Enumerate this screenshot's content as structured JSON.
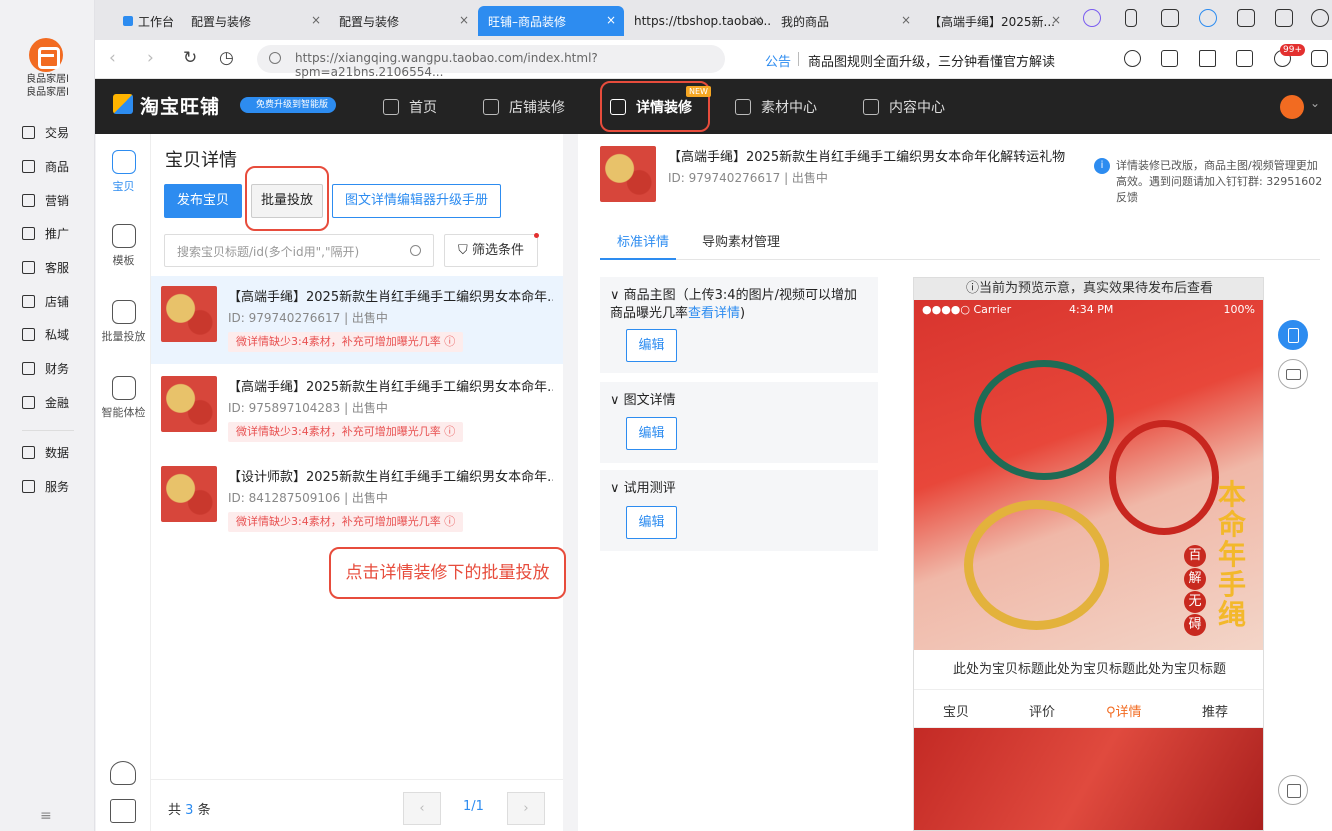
{
  "sidebar": {
    "app_name": "良品家居l\n良品家居l",
    "items": [
      {
        "label": "交易",
        "icon": "receipt-icon"
      },
      {
        "label": "商品",
        "icon": "goods-icon"
      },
      {
        "label": "营销",
        "icon": "coupon-icon"
      },
      {
        "label": "推广",
        "icon": "send-icon"
      },
      {
        "label": "客服",
        "icon": "headset-icon"
      },
      {
        "label": "店铺",
        "icon": "store-icon"
      },
      {
        "label": "私域",
        "icon": "users-icon"
      },
      {
        "label": "财务",
        "icon": "finance-icon"
      },
      {
        "label": "金融",
        "icon": "bag-icon"
      },
      {
        "label": "数据",
        "icon": "chart-icon"
      },
      {
        "label": "服务",
        "icon": "service-icon"
      }
    ]
  },
  "browser": {
    "tabs": [
      {
        "label": "工作台",
        "active": false
      },
      {
        "label": "配置与装修",
        "active": false
      },
      {
        "label": "配置与装修",
        "active": false
      },
      {
        "label": "旺铺–商品装修",
        "active": true
      },
      {
        "label": "https://tbshop.taobao...",
        "active": false
      },
      {
        "label": "我的商品",
        "active": false
      },
      {
        "label": "【高端手绳】2025新...",
        "active": false
      }
    ],
    "close_glyph": "×",
    "url": "https://xiangqing.wangpu.taobao.com/index.html?spm=a21bns.2106554...",
    "notice_label": "公告",
    "notice_text": "商品图规则全面升级，三分钟看懂官方解读",
    "badge": "99+"
  },
  "header": {
    "brand": "淘宝旺铺",
    "brand_badge": "免费升级到智能版",
    "nav": [
      {
        "label": "首页",
        "icon": "home-icon"
      },
      {
        "label": "店铺装修",
        "icon": "shop-icon"
      },
      {
        "label": "详情装修",
        "icon": "document-icon"
      },
      {
        "label": "素材中心",
        "icon": "folder-icon"
      },
      {
        "label": "内容中心",
        "icon": "play-icon"
      }
    ],
    "new_tag": "NEW"
  },
  "tools": [
    {
      "label": "宝贝"
    },
    {
      "label": "模板"
    },
    {
      "label": "批量投放"
    },
    {
      "label": "智能体检"
    }
  ],
  "list": {
    "title": "宝贝详情",
    "btn_publish": "发布宝贝",
    "btn_batch": "批量投放",
    "btn_manual": "图文详情编辑器升级手册",
    "search_placeholder": "搜索宝贝标题/id(多个id用\",\"隔开)",
    "filter_label": "筛选条件",
    "items": [
      {
        "title": "【高端手绳】2025新款生肖红手绳手工编织男女本命年...",
        "id": "ID: 979740276617 | 出售中",
        "warn": "微详情缺少3:4素材，补充可增加曝光几率 ⓘ"
      },
      {
        "title": "【高端手绳】2025新款生肖红手绳手工编织男女本命年...",
        "id": "ID: 975897104283 | 出售中",
        "warn": "微详情缺少3:4素材，补充可增加曝光几率 ⓘ"
      },
      {
        "title": "【设计师款】2025新款生肖红手绳手工编织男女本命年...",
        "id": "ID: 841287509106 | 出售中",
        "warn": "微详情缺少3:4素材，补充可增加曝光几率 ⓘ"
      }
    ],
    "annotation": "点击详情装修下的批量投放",
    "total_prefix": "共",
    "total_count": "3",
    "total_suffix": "条",
    "page": "1/1",
    "prev": "‹",
    "next": "›"
  },
  "preview": {
    "title": "【高端手绳】2025新款生肖红手绳手工编织男女本命年化解转运礼物",
    "id": "ID: 979740276617 | 出售中",
    "info": "详情装修已改版，商品主图/视频管理更加高效。遇到问题请加入钉钉群: 32951602 反馈",
    "tabs": [
      "标准详情",
      "导购素材管理"
    ],
    "sections": [
      {
        "title": "∨ 商品主图（上传3:4的图片/视频可以增加商品曝光几率",
        "link": "查看详情",
        "tail": ")",
        "btn": "编辑"
      },
      {
        "title": "∨ 图文详情",
        "link": "",
        "tail": "",
        "btn": "编辑"
      },
      {
        "title": "∨ 试用测评",
        "link": "",
        "tail": "",
        "btn": "编辑"
      }
    ],
    "phone": {
      "notice": "ⓘ当前为预览示意，真实效果待发布后查看",
      "carrier": "●●●●○ Carrier",
      "time": "4:34 PM",
      "battery": "100%",
      "vertical_text": "本命年手绳",
      "vertical_sub": [
        "百",
        "解",
        "无",
        "碍"
      ],
      "caption": "此处为宝贝标题此处为宝贝标题此处为宝贝标题",
      "tabs": [
        "宝贝",
        "评价",
        "详情",
        "推荐"
      ]
    }
  },
  "colors": {
    "accent": "#2d8cf0",
    "brand_orange": "#f26b21",
    "highlight_red": "#e74c3c",
    "header_bg": "#232323"
  }
}
